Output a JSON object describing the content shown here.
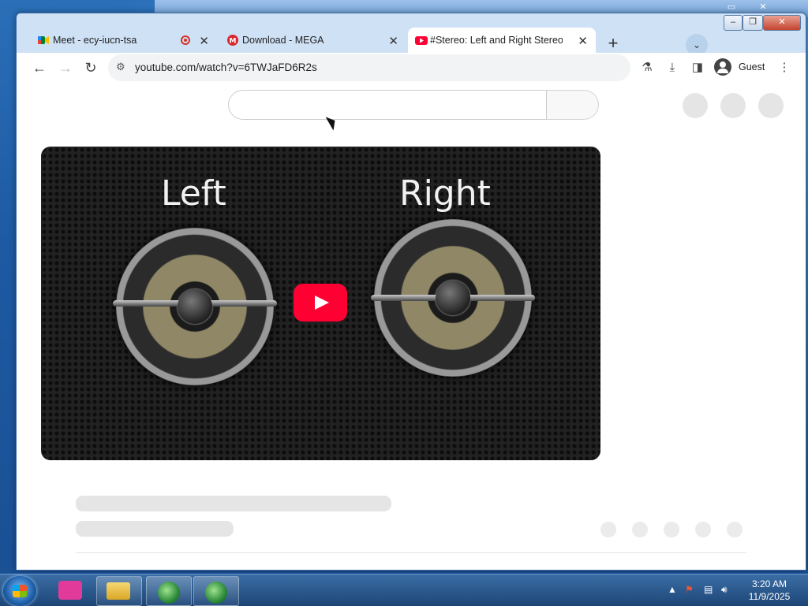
{
  "tabs": [
    {
      "title": "Meet - ecy-iucn-tsa",
      "favicon": "google-meet-icon",
      "recording": true
    },
    {
      "title": "Download - MEGA",
      "favicon": "mega-icon"
    },
    {
      "title": "#Stereo: Left and Right Stereo S",
      "favicon": "youtube-icon",
      "active": true
    }
  ],
  "address_bar": {
    "url": "youtube.com/watch?v=6TWJaFD6R2s"
  },
  "profile": {
    "name": "Guest"
  },
  "video": {
    "left_label": "Left",
    "right_label": "Right"
  },
  "taskbar": {
    "time": "3:20 AM",
    "date": "11/9/2025"
  },
  "colors": {
    "youtube_red": "#ff0033",
    "mega_red": "#d9272e",
    "meet_accent": "#00832d"
  }
}
